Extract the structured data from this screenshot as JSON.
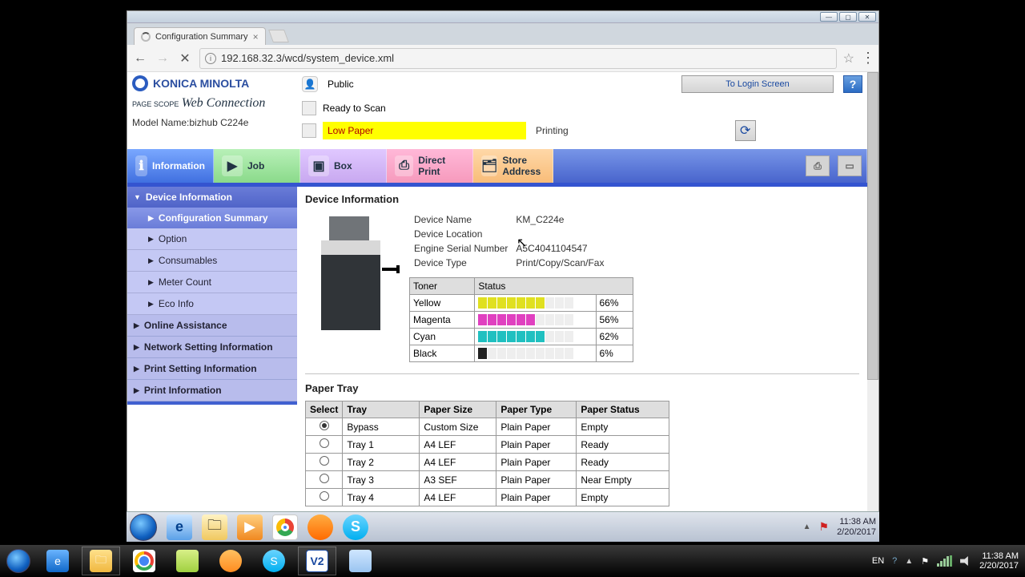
{
  "browser": {
    "tab_title": "Configuration Summary",
    "url": "192.168.32.3/wcd/system_device.xml"
  },
  "brand": {
    "name": "KONICA MINOLTA",
    "pagescope": "PAGE SCOPE",
    "webconn": "Web Connection",
    "model_label": "Model Name:",
    "model": "bizhub C224e"
  },
  "header": {
    "user_mode": "Public",
    "login_button": "To Login Screen",
    "status_ready": "Ready to Scan",
    "status_warn": "Low Paper",
    "printing": "Printing"
  },
  "tabs": {
    "information": "Information",
    "job": "Job",
    "box": "Box",
    "direct_print": "Direct Print",
    "store_address": "Store Address"
  },
  "sidebar": {
    "device_information": "Device Information",
    "configuration_summary": "Configuration Summary",
    "option": "Option",
    "consumables": "Consumables",
    "meter_count": "Meter Count",
    "eco_info": "Eco Info",
    "online_assistance": "Online Assistance",
    "network_setting_information": "Network Setting Information",
    "print_setting_information": "Print Setting Information",
    "print_information": "Print Information"
  },
  "device_info": {
    "title": "Device Information",
    "fields": {
      "device_name_label": "Device Name",
      "device_name": "KM_C224e",
      "device_location_label": "Device Location",
      "device_location": "",
      "serial_label": "Engine Serial Number",
      "serial": "A5C4041104547",
      "device_type_label": "Device Type",
      "device_type": "Print/Copy/Scan/Fax"
    },
    "toner": {
      "col_toner": "Toner",
      "col_status": "Status",
      "rows": [
        {
          "name": "Yellow",
          "pct": "66%",
          "filled": 7,
          "class": "y"
        },
        {
          "name": "Magenta",
          "pct": "56%",
          "filled": 6,
          "class": "m"
        },
        {
          "name": "Cyan",
          "pct": "62%",
          "filled": 7,
          "class": "c"
        },
        {
          "name": "Black",
          "pct": "6%",
          "filled": 1,
          "class": "k"
        }
      ]
    }
  },
  "paper_tray": {
    "title": "Paper Tray",
    "cols": {
      "select": "Select",
      "tray": "Tray",
      "size": "Paper Size",
      "type": "Paper Type",
      "status": "Paper Status"
    },
    "rows": [
      {
        "selected": true,
        "tray": "Bypass",
        "size": "Custom Size",
        "type": "Plain Paper",
        "status": "Empty"
      },
      {
        "selected": false,
        "tray": "Tray 1",
        "size": "A4 LEF",
        "type": "Plain Paper",
        "status": "Ready"
      },
      {
        "selected": false,
        "tray": "Tray 2",
        "size": "A4 LEF",
        "type": "Plain Paper",
        "status": "Ready"
      },
      {
        "selected": false,
        "tray": "Tray 3",
        "size": "A3 SEF",
        "type": "Plain Paper",
        "status": "Near Empty"
      },
      {
        "selected": false,
        "tray": "Tray 4",
        "size": "A4 LEF",
        "type": "Plain Paper",
        "status": "Empty"
      }
    ]
  },
  "inner_tray": {
    "time": "11:38 AM",
    "date": "2/20/2017"
  },
  "host_tray": {
    "lang": "EN",
    "time": "11:38 AM",
    "date": "2/20/2017"
  }
}
